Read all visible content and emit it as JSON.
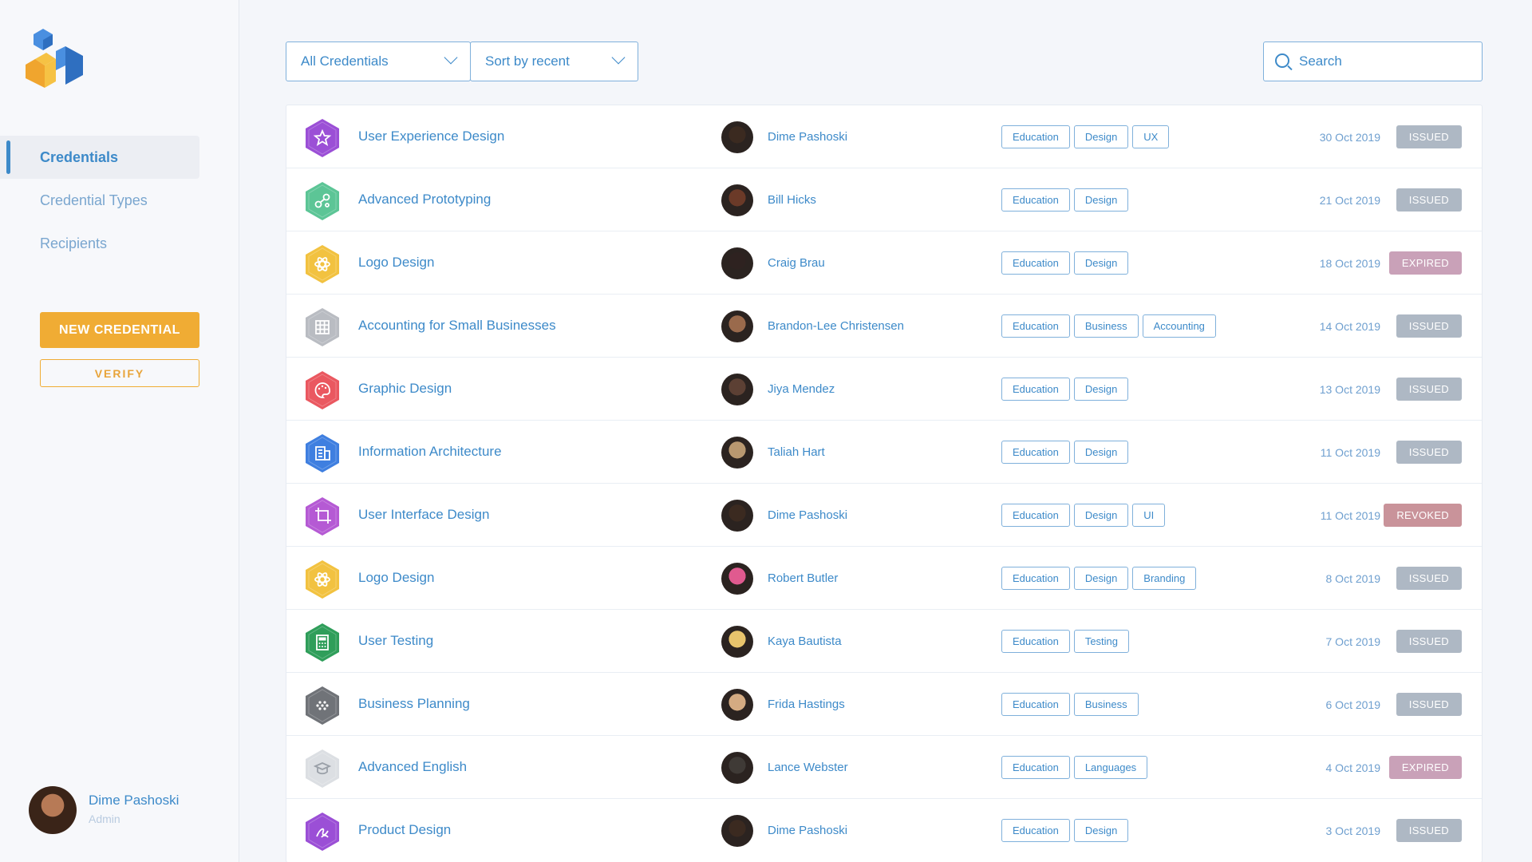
{
  "sidebar": {
    "nav": [
      {
        "label": "Credentials",
        "active": true
      },
      {
        "label": "Credential Types",
        "active": false
      },
      {
        "label": "Recipients",
        "active": false
      }
    ],
    "new_button": "NEW CREDENTIAL",
    "verify_button": "VERIFY",
    "user": {
      "name": "Dime Pashoski",
      "role": "Admin"
    }
  },
  "toolbar": {
    "filter_value": "All Credentials",
    "sort_value": "Sort by recent",
    "search_placeholder": "Search"
  },
  "status_colors": {
    "ISSUED": "#aeb8c4",
    "EXPIRED": "#c9a1b8",
    "REVOKED": "#c9939a"
  },
  "credentials": [
    {
      "name": "User Experience Design",
      "icon": "star-icon",
      "color": "#9b4fd6",
      "person": "Dime Pashoski",
      "avatar": "#3b2a20",
      "tags": [
        "Education",
        "Design",
        "UX"
      ],
      "date": "30 Oct 2019",
      "status": "ISSUED"
    },
    {
      "name": "Advanced Prototyping",
      "icon": "nodes-icon",
      "color": "#5cc596",
      "person": "Bill Hicks",
      "avatar": "#6b3a28",
      "tags": [
        "Education",
        "Design"
      ],
      "date": "21 Oct 2019",
      "status": "ISSUED"
    },
    {
      "name": "Logo Design",
      "icon": "atom-icon",
      "color": "#f2c240",
      "person": "Craig Brau",
      "avatar": "#2e2220",
      "tags": [
        "Education",
        "Design"
      ],
      "date": "18 Oct 2019",
      "status": "EXPIRED"
    },
    {
      "name": "Accounting for Small Businesses",
      "icon": "grid-icon",
      "color": "#b9bcc2",
      "person": "Brandon-Lee Christensen",
      "avatar": "#9a6a4c",
      "tags": [
        "Education",
        "Business",
        "Accounting"
      ],
      "date": "14 Oct 2019",
      "status": "ISSUED"
    },
    {
      "name": "Graphic Design",
      "icon": "palette-icon",
      "color": "#ea5860",
      "person": "Jiya Mendez",
      "avatar": "#5c4034",
      "tags": [
        "Education",
        "Design"
      ],
      "date": "13 Oct 2019",
      "status": "ISSUED"
    },
    {
      "name": "Information Architecture",
      "icon": "building-icon",
      "color": "#3f7fe0",
      "person": "Taliah Hart",
      "avatar": "#b89870",
      "tags": [
        "Education",
        "Design"
      ],
      "date": "11 Oct 2019",
      "status": "ISSUED"
    },
    {
      "name": "User Interface Design",
      "icon": "crop-icon",
      "color": "#b55ad4",
      "person": "Dime Pashoski",
      "avatar": "#3b2a20",
      "tags": [
        "Education",
        "Design",
        "UI"
      ],
      "date": "11 Oct 2019",
      "status": "REVOKED"
    },
    {
      "name": "Logo Design",
      "icon": "atom-icon",
      "color": "#f2c240",
      "person": "Robert Butler",
      "avatar": "#e05a8f",
      "tags": [
        "Education",
        "Design",
        "Branding"
      ],
      "date": "8 Oct 2019",
      "status": "ISSUED"
    },
    {
      "name": "User Testing",
      "icon": "calculator-icon",
      "color": "#2f9e5a",
      "person": "Kaya Bautista",
      "avatar": "#e8c46c",
      "tags": [
        "Education",
        "Testing"
      ],
      "date": "7 Oct 2019",
      "status": "ISSUED"
    },
    {
      "name": "Business Planning",
      "icon": "dots-icon",
      "color": "#707378",
      "person": "Frida Hastings",
      "avatar": "#d4ab82",
      "tags": [
        "Education",
        "Business"
      ],
      "date": "6 Oct 2019",
      "status": "ISSUED"
    },
    {
      "name": "Advanced English",
      "icon": "graduation-cap-icon",
      "color": "#dcdfe3",
      "person": "Lance Webster",
      "avatar": "#3f3a36",
      "tags": [
        "Education",
        "Languages"
      ],
      "date": "4 Oct 2019",
      "status": "EXPIRED"
    },
    {
      "name": "Product Design",
      "icon": "pen-icon",
      "color": "#9b4fd6",
      "person": "Dime Pashoski",
      "avatar": "#3b2a20",
      "tags": [
        "Education",
        "Design"
      ],
      "date": "3 Oct 2019",
      "status": "ISSUED"
    }
  ]
}
